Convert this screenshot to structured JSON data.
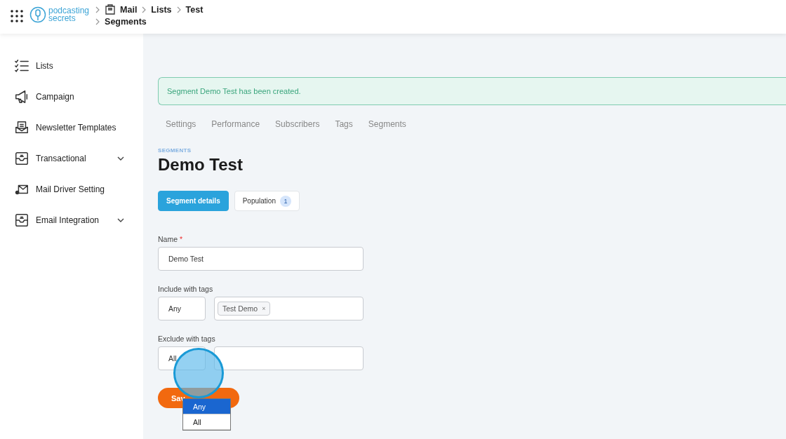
{
  "header": {
    "logo": {
      "line1": "podcasting",
      "line2": "secrets"
    },
    "breadcrumb": [
      {
        "label": "Mail",
        "icon": true
      },
      {
        "label": "Lists"
      },
      {
        "label": "Test"
      },
      {
        "label": "Segments"
      }
    ]
  },
  "sidebar": {
    "items": [
      {
        "label": "Lists",
        "kind": "checklist",
        "expandable": false
      },
      {
        "label": "Campaign",
        "kind": "megaphone",
        "expandable": false
      },
      {
        "label": "Newsletter Templates",
        "kind": "template",
        "expandable": false
      },
      {
        "label": "Transactional",
        "kind": "inbox",
        "expandable": true
      },
      {
        "label": "Mail Driver Setting",
        "kind": "envelope",
        "expandable": false
      },
      {
        "label": "Email Integration",
        "kind": "inbox",
        "expandable": true
      }
    ]
  },
  "alert": "Segment Demo Test has been created.",
  "tabs": [
    "Settings",
    "Performance",
    "Subscribers",
    "Tags",
    "Segments"
  ],
  "eyebrow": "SEGMENTS",
  "title": "Demo Test",
  "subtabs": [
    {
      "label": "Segment details",
      "selected": true
    },
    {
      "label": "Population",
      "selected": false,
      "badge": "1"
    }
  ],
  "form": {
    "name": {
      "label": "Name",
      "required": "*",
      "value": "Demo Test"
    },
    "include": {
      "label": "Include with tags",
      "match": "Any",
      "tags": [
        {
          "label": "Test Demo",
          "remove": "×"
        }
      ]
    },
    "exclude": {
      "label": "Exclude with tags",
      "match": "All"
    },
    "save": "Sav"
  },
  "dropdown": [
    {
      "label": "Any",
      "selected": true
    },
    {
      "label": "All",
      "selected": false
    }
  ]
}
